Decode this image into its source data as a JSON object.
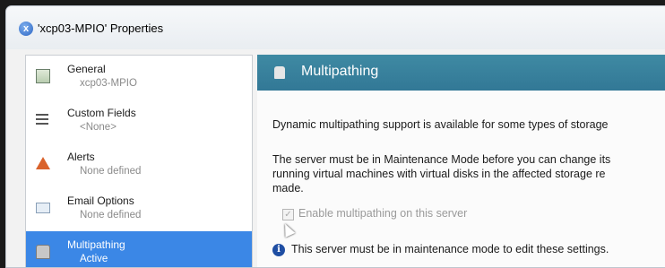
{
  "window": {
    "title": "'xcp03-MPIO' Properties",
    "accent": "#3b87e6",
    "header_color": "#3a8199"
  },
  "sidebar": {
    "items": [
      {
        "label": "General",
        "sub": "xcp03-MPIO",
        "icon": "general-icon"
      },
      {
        "label": "Custom Fields",
        "sub": "<None>",
        "icon": "list-icon"
      },
      {
        "label": "Alerts",
        "sub": "None defined",
        "icon": "alert-icon"
      },
      {
        "label": "Email Options",
        "sub": "None defined",
        "icon": "mail-icon"
      },
      {
        "label": "Multipathing",
        "sub": "Active",
        "icon": "disk-icon",
        "selected": true
      }
    ]
  },
  "panel": {
    "title": "Multipathing",
    "para1": "Dynamic multipathing support is available for some types of storage",
    "para2_line1": "The server must be in Maintenance Mode before you can change its",
    "para2_line2": "running virtual machines with virtual disks in the affected storage re",
    "para2_line3": "made.",
    "checkbox_label": "Enable multipathing on this server",
    "checkbox_checked": true,
    "checkbox_enabled": false,
    "info_text": "This server must be in maintenance mode to edit these settings."
  }
}
